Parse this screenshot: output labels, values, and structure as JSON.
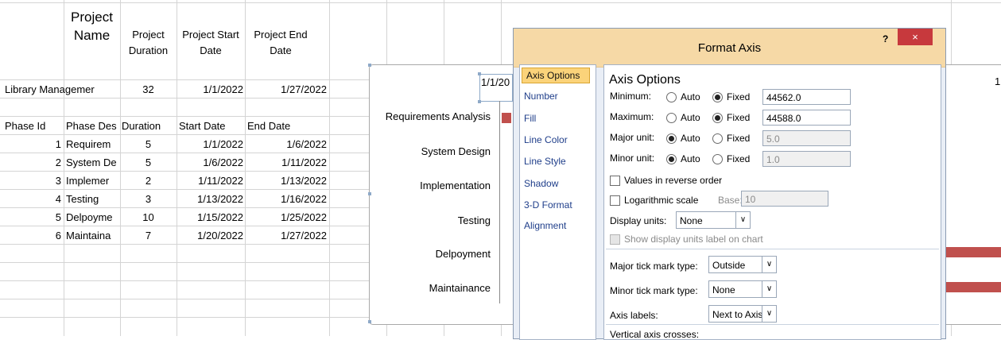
{
  "sheet": {
    "header": {
      "name": "Project Name",
      "duration": "Project Duration",
      "start": "Project Start Date",
      "end": "Project End Date"
    },
    "project_row": [
      "Library Managemer",
      "32",
      "1/1/2022",
      "1/27/2022"
    ],
    "phase_header": [
      "Phase Id",
      "Phase Des",
      "Duration",
      "Start Date",
      "End Date"
    ],
    "phases": [
      [
        "1",
        "Requirem",
        "5",
        "1/1/2022",
        "1/6/2022"
      ],
      [
        "2",
        "System De",
        "5",
        "1/6/2022",
        "1/11/2022"
      ],
      [
        "3",
        "Implemer",
        "2",
        "1/11/2022",
        "1/13/2022"
      ],
      [
        "4",
        "Testing",
        "3",
        "1/13/2022",
        "1/16/2022"
      ],
      [
        "5",
        "Delpoyme",
        "10",
        "1/15/2022",
        "1/25/2022"
      ],
      [
        "6",
        "Maintaina",
        "7",
        "1/20/2022",
        "1/27/2022"
      ]
    ]
  },
  "chart": {
    "top_left_tick": "1/1/20",
    "top_right_tick": "1",
    "categories": [
      "Requirements Analysis",
      "System Design",
      "Implementation",
      "Testing",
      "Delpoyment",
      "Maintainance"
    ],
    "bar_color": "#c0504d"
  },
  "dialog": {
    "title": "Format Axis",
    "help_label": "?",
    "close_label": "×",
    "nav": [
      "Axis Options",
      "Number",
      "Fill",
      "Line Color",
      "Line Style",
      "Shadow",
      "3-D Format",
      "Alignment"
    ],
    "pane_title": "Axis Options",
    "minimum": {
      "label": "Minimum:",
      "auto": "Auto",
      "fixed": "Fixed",
      "value": "44562.0"
    },
    "maximum": {
      "label": "Maximum:",
      "auto": "Auto",
      "fixed": "Fixed",
      "value": "44588.0"
    },
    "major_unit": {
      "label": "Major unit:",
      "auto": "Auto",
      "fixed": "Fixed",
      "value": "5.0"
    },
    "minor_unit": {
      "label": "Minor unit:",
      "auto": "Auto",
      "fixed": "Fixed",
      "value": "1.0"
    },
    "reverse_order": "Values in reverse order",
    "log_scale": "Logarithmic scale",
    "base_label": "Base:",
    "base_value": "10",
    "display_units_label": "Display units:",
    "display_units_value": "None",
    "show_units_label": "Show display units label on chart",
    "major_tick_label": "Major tick mark type:",
    "major_tick_value": "Outside",
    "minor_tick_label": "Minor tick mark type:",
    "minor_tick_value": "None",
    "axis_labels_label": "Axis labels:",
    "axis_labels_value": "Next to Axis",
    "vertical_crosses": "Vertical axis crosses:"
  }
}
